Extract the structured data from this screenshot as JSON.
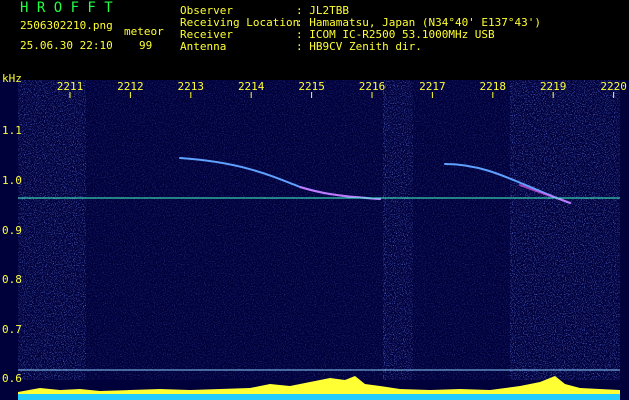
{
  "header": {
    "logo": "H R O F F T",
    "filename": "2506302210.png",
    "datetime": "25.06.30 22:10",
    "mode": "meteor",
    "count": "99",
    "rows": [
      {
        "label": "Observer",
        "value": ": JL2TBB"
      },
      {
        "label": "Receiving Location",
        "value": ": Hamamatsu, Japan (N34°40' E137°43')"
      },
      {
        "label": "Receiver",
        "value": ": ICOM IC-R2500 53.1000MHz USB"
      },
      {
        "label": "Antenna",
        "value": ": HB9CV Zenith dir."
      }
    ]
  },
  "axis": {
    "unit": "kHz",
    "y_ticks": [
      "1.1",
      "1.0",
      "0.9",
      "0.8",
      "0.7",
      "0.6"
    ],
    "x_ticks": [
      "2211",
      "2212",
      "2213",
      "2214",
      "2215",
      "2216",
      "2217",
      "2218",
      "2219",
      "2220"
    ]
  },
  "colors": {
    "text_green": "#22ff44",
    "text_yellow": "#ffff33",
    "reference_line": "#44ffcc",
    "noise": "#1a2a9a",
    "signal": "#ffff33"
  }
}
